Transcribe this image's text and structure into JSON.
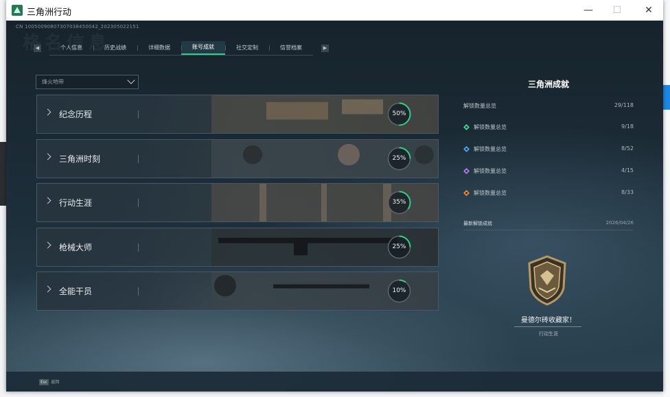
{
  "window": {
    "title": "三角洲行动",
    "controls": {
      "minimize": "—",
      "maximize": "☐",
      "close": "✕"
    }
  },
  "header": {
    "uid_text": "CN 10050090807307038450042_202305022151",
    "ghost_title": "格名信息"
  },
  "tabs": [
    {
      "label": "个人信息",
      "active": false
    },
    {
      "label": "历史战绩",
      "active": false
    },
    {
      "label": "详细数据",
      "active": false
    },
    {
      "label": "账号成就",
      "active": true
    },
    {
      "label": "社交定制",
      "active": false
    },
    {
      "label": "信誉档案",
      "active": false
    }
  ],
  "tab_nav": {
    "prev": "◀",
    "next": "▶"
  },
  "filter": {
    "value": "烽火地带"
  },
  "categories": [
    {
      "label": "纪念历程",
      "percent": 50,
      "percent_text": "50%"
    },
    {
      "label": "三角洲时刻",
      "percent": 25,
      "percent_text": "25%"
    },
    {
      "label": "行动生涯",
      "percent": 35,
      "percent_text": "35%"
    },
    {
      "label": "枪械大师",
      "percent": 25,
      "percent_text": "25%"
    },
    {
      "label": "全能干员",
      "percent": 10,
      "percent_text": "10%"
    }
  ],
  "panel": {
    "title": "三角洲成就",
    "total": {
      "label": "解锁数量总览",
      "value": "29/118"
    },
    "tiers": [
      {
        "label": "解锁数量总览",
        "value": "9/18",
        "icon": "green-tier-icon",
        "color": "#3bd18f"
      },
      {
        "label": "解锁数量总览",
        "value": "8/52",
        "icon": "blue-tier-icon",
        "color": "#4aa3f0"
      },
      {
        "label": "解锁数量总览",
        "value": "4/15",
        "icon": "purple-tier-icon",
        "color": "#b07be8"
      },
      {
        "label": "解锁数量总览",
        "value": "8/33",
        "icon": "orange-tier-icon",
        "color": "#e8893a"
      }
    ],
    "latest": {
      "label": "最新解锁成就",
      "date": "2026/04/26",
      "name": "曼德尔砖收藏家！",
      "category": "行动生涯"
    }
  },
  "bottom": {
    "key": "Esc",
    "action": "返回"
  },
  "colors": {
    "accent": "#2fd08a",
    "bg_dark": "#101820"
  }
}
